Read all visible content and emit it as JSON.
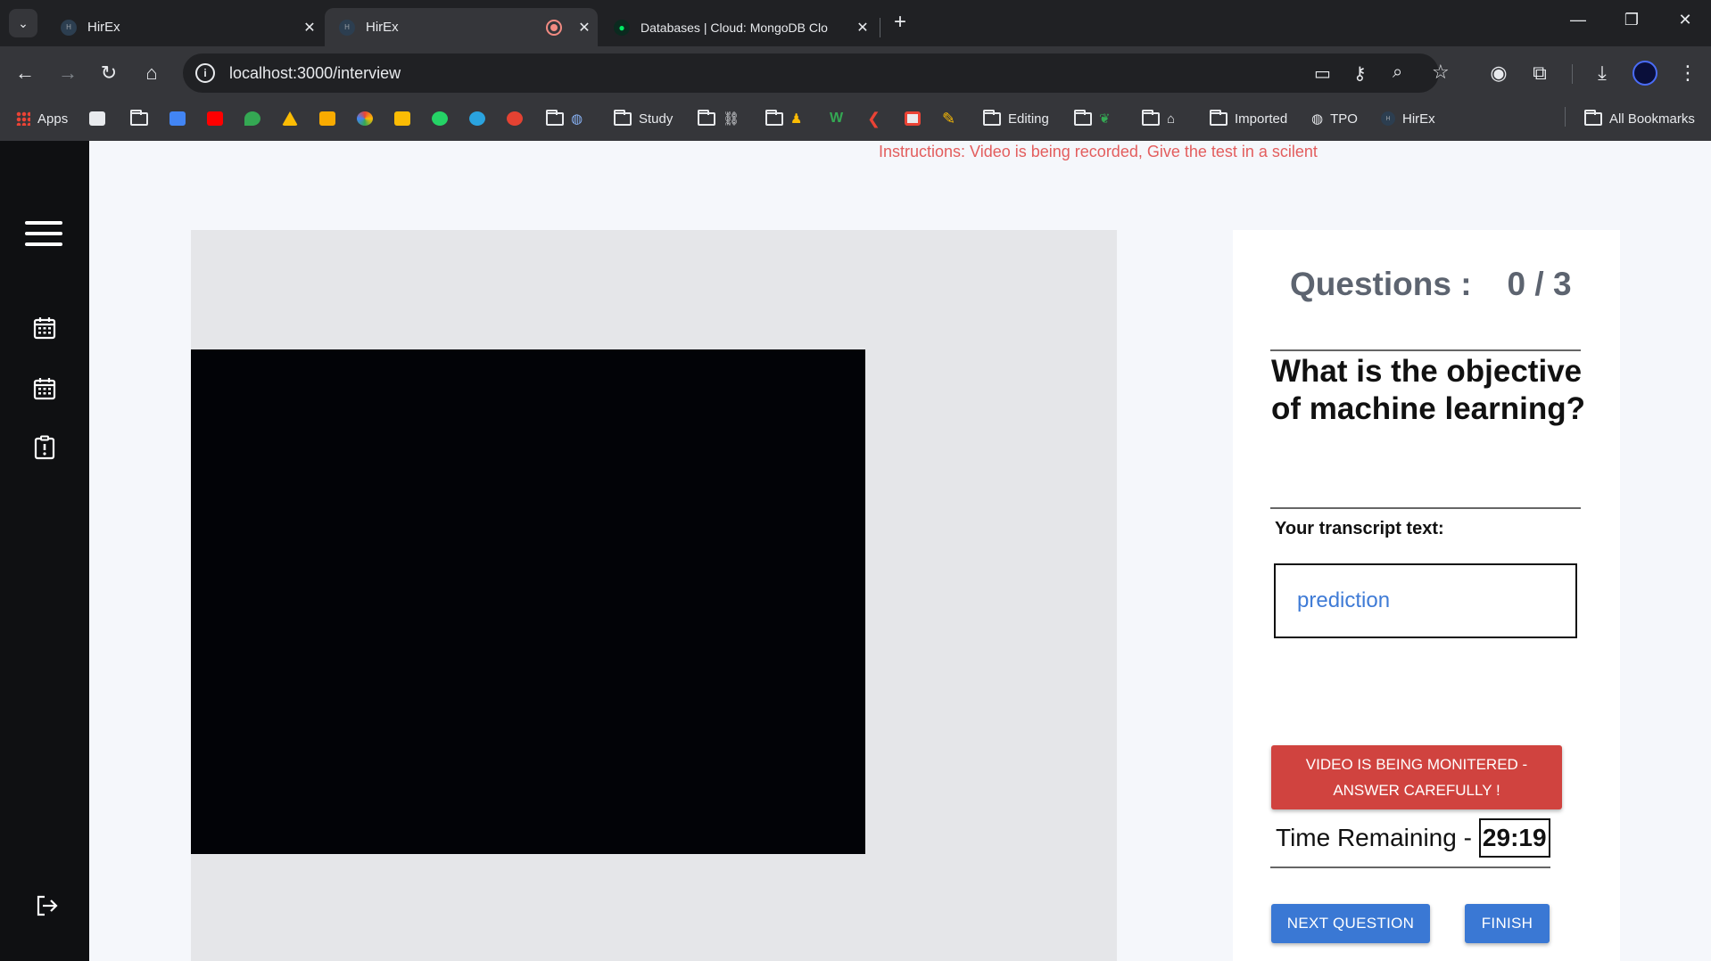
{
  "browser": {
    "tabs": [
      {
        "title": "HirEx"
      },
      {
        "title": "HirEx"
      },
      {
        "title": "Databases | Cloud: MongoDB Clo"
      }
    ],
    "url": "localhost:3000/interview",
    "bookmarks": [
      {
        "label": "Apps"
      },
      {
        "label": "Study"
      },
      {
        "label": "Editing"
      },
      {
        "label": "Imported"
      },
      {
        "label": "TPO"
      },
      {
        "label": "HirEx"
      },
      {
        "label": "All Bookmarks"
      }
    ]
  },
  "page": {
    "instructions": "Instructions: Video is being recorded, Give the test in a scilent",
    "questions_label": "Questions :",
    "questions_count": "0 / 3",
    "question_text": "What is the objective of machine learning?",
    "transcript_label": "Your transcript text:",
    "transcript_value": "prediction",
    "warning_line1": "VIDEO IS BEING MONITERED -",
    "warning_line2": "ANSWER CAREFULLY !",
    "time_label": "Time Remaining -",
    "time_value": "29:19",
    "next_button": "NEXT QUESTION",
    "finish_button": "FINISH"
  },
  "colors": {
    "accent": "#3a78d4",
    "warning": "#d0433f",
    "instruction_text": "#e35d5d",
    "sidebar": "#0f1012"
  }
}
